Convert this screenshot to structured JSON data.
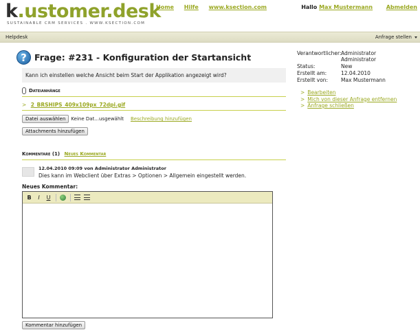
{
  "logo": {
    "main_k": "k",
    "main_rest": ".ustomer.desk",
    "tagline": "SUSTAINABLE CRM SERVICES . WWW.KSECTION.COM"
  },
  "topnav": {
    "home": "Home",
    "help": "Hilfe",
    "site": "www.ksection.com"
  },
  "user": {
    "greeting": "Hallo",
    "name": "Max Mustermann",
    "logout": "Abmelden"
  },
  "menubar": {
    "left": "Helpdesk",
    "right": "Anfrage stellen"
  },
  "page": {
    "title": "Frage: #231 - Konfiguration der Startansicht"
  },
  "question": {
    "text": "Kann ich einstellen welche Ansicht beim Start der Applikation angezeigt wird?"
  },
  "attachments": {
    "heading": "Dateianhänge",
    "file_prefix": ">",
    "file_name": "2_BRSHIPS_409x109px_72dpi.gif",
    "choose_file": "Datei auswählen",
    "no_file": "Keine Dat...usgewählt",
    "add_description": "Beschreibung hinzufügen",
    "add_button": "Attachments hinzufügen"
  },
  "comments": {
    "heading": "Kommentare",
    "count": "(1)",
    "new_link": "Neues Kommentar",
    "items": [
      {
        "meta": "12.04.2010 09:09 von Administrator Administrator",
        "text": "Dies kann im Webclient über Extras > Optionen > Allgemein eingestellt werden."
      }
    ]
  },
  "new_comment": {
    "label": "Neues Kommentar:",
    "submit": "Kommentar hinzufügen"
  },
  "editor": {
    "bold": "B",
    "italic": "I",
    "underline": "U",
    "icons": [
      "globe-icon",
      "ordered-list-icon",
      "unordered-list-icon"
    ]
  },
  "details": {
    "responsible_label": "Verantwortlicher:",
    "responsible_value_1": "Administrator",
    "responsible_value_2": "Administrator",
    "status_label": "Status:",
    "status_value": "New",
    "created_label": "Erstellt am:",
    "created_value": "12.04.2010",
    "creator_label": "Erstellt von:",
    "creator_value": "Max Mustermann"
  },
  "actions": {
    "prefix": ">",
    "edit": "Bearbeiten",
    "remove": "Mich von dieser Anfrage entfernen",
    "close": "Anfrage schließen"
  },
  "colors": {
    "accent": "#9aa820",
    "logo": "#8fa22b",
    "menubar": "#e4e3cb",
    "toolbar": "#eceabf"
  }
}
